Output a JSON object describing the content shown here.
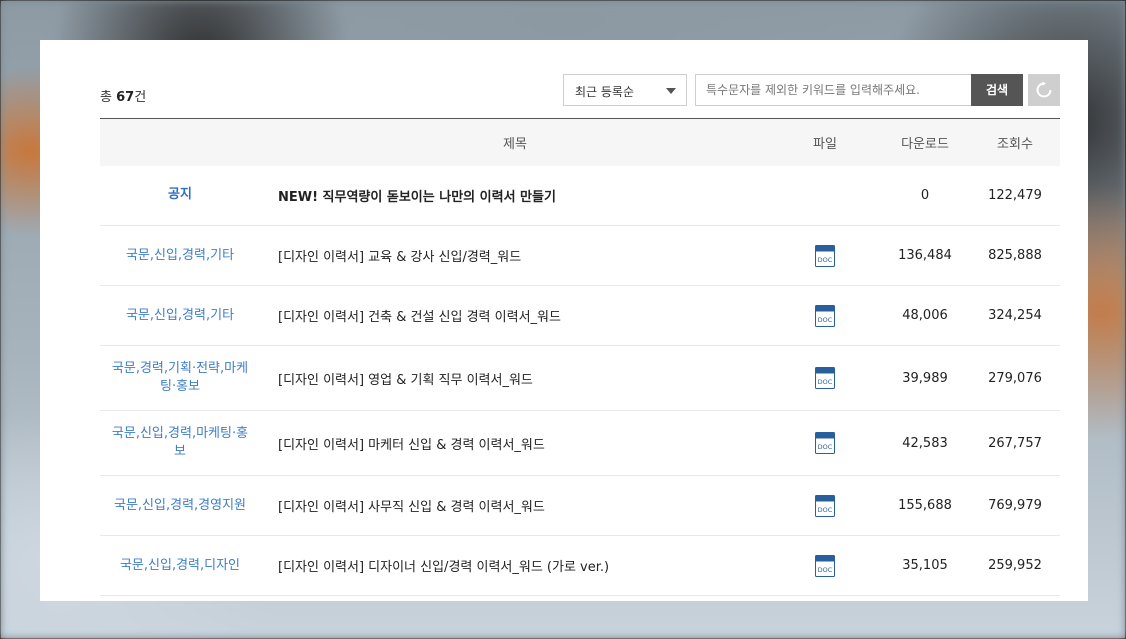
{
  "summary": {
    "prefix": "총 ",
    "count": "67",
    "suffix": "건"
  },
  "sort": {
    "selected": "최근 등록순"
  },
  "search": {
    "placeholder": "특수문자를 제외한 키워드를 입력해주세요.",
    "button_label": "검색"
  },
  "table": {
    "headers": {
      "category": "",
      "title": "제목",
      "file": "파일",
      "downloads": "다운로드",
      "views": "조회수"
    },
    "rows": [
      {
        "category": "공지",
        "title": "NEW! 직무역량이 돋보이는 나만의 이력서 만들기",
        "has_file": false,
        "downloads": "0",
        "views": "122,479"
      },
      {
        "category": "국문,신입,경력,기타",
        "title": "[디자인 이력서] 교육 & 강사 신입/경력_워드",
        "has_file": true,
        "file_icon": "doc-file-icon",
        "downloads": "136,484",
        "views": "825,888"
      },
      {
        "category": "국문,신입,경력,기타",
        "title": "[디자인 이력서] 건축 & 건설 신입 경력 이력서_워드",
        "has_file": true,
        "file_icon": "doc-file-icon",
        "downloads": "48,006",
        "views": "324,254"
      },
      {
        "category": "국문,경력,기획·전략,마케팅·홍보",
        "title": "[디자인 이력서] 영업 & 기획 직무 이력서_워드",
        "has_file": true,
        "file_icon": "doc-file-icon",
        "downloads": "39,989",
        "views": "279,076"
      },
      {
        "category": "국문,신입,경력,마케팅·홍보",
        "title": "[디자인 이력서] 마케터 신입 & 경력 이력서_워드",
        "has_file": true,
        "file_icon": "doc-file-icon",
        "downloads": "42,583",
        "views": "267,757"
      },
      {
        "category": "국문,신입,경력,경영지원",
        "title": "[디자인 이력서] 사무직 신입 & 경력 이력서_워드",
        "has_file": true,
        "file_icon": "doc-file-icon",
        "downloads": "155,688",
        "views": "769,979"
      },
      {
        "category": "국문,신입,경력,디자인",
        "title": "[디자인 이력서] 디자이너 신입/경력 이력서_워드 (가로 ver.)",
        "has_file": true,
        "file_icon": "doc-file-icon",
        "downloads": "35,105",
        "views": "259,952"
      }
    ]
  },
  "colors": {
    "category_link": "#3d7ec9",
    "search_button": "#555555",
    "doc_icon": "#2a5f9e"
  }
}
